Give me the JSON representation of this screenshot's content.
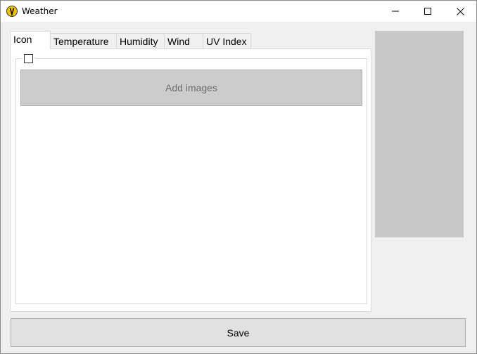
{
  "window": {
    "title": "Weather",
    "icon": "weather-app-icon",
    "controls": {
      "minimize_icon": "minimize-icon",
      "maximize_icon": "maximize-icon",
      "close_icon": "close-icon"
    }
  },
  "tabs": [
    {
      "label": "Icon",
      "active": true
    },
    {
      "label": "Temperature",
      "active": false
    },
    {
      "label": "Humidity",
      "active": false
    },
    {
      "label": "Wind",
      "active": false
    },
    {
      "label": "UV Index",
      "active": false
    }
  ],
  "icon_tab": {
    "enabled_checkbox": {
      "checked": false
    },
    "add_images_label": "Add images"
  },
  "footer": {
    "save_label": "Save"
  },
  "colors": {
    "title_bar": "#ffffff",
    "window_bg": "#f0f0f0",
    "preview_bg": "#c8c8c8",
    "add_button_bg": "#cccccc",
    "add_button_text": "#6d6d6d",
    "app_icon_yellow": "#f2c200"
  }
}
